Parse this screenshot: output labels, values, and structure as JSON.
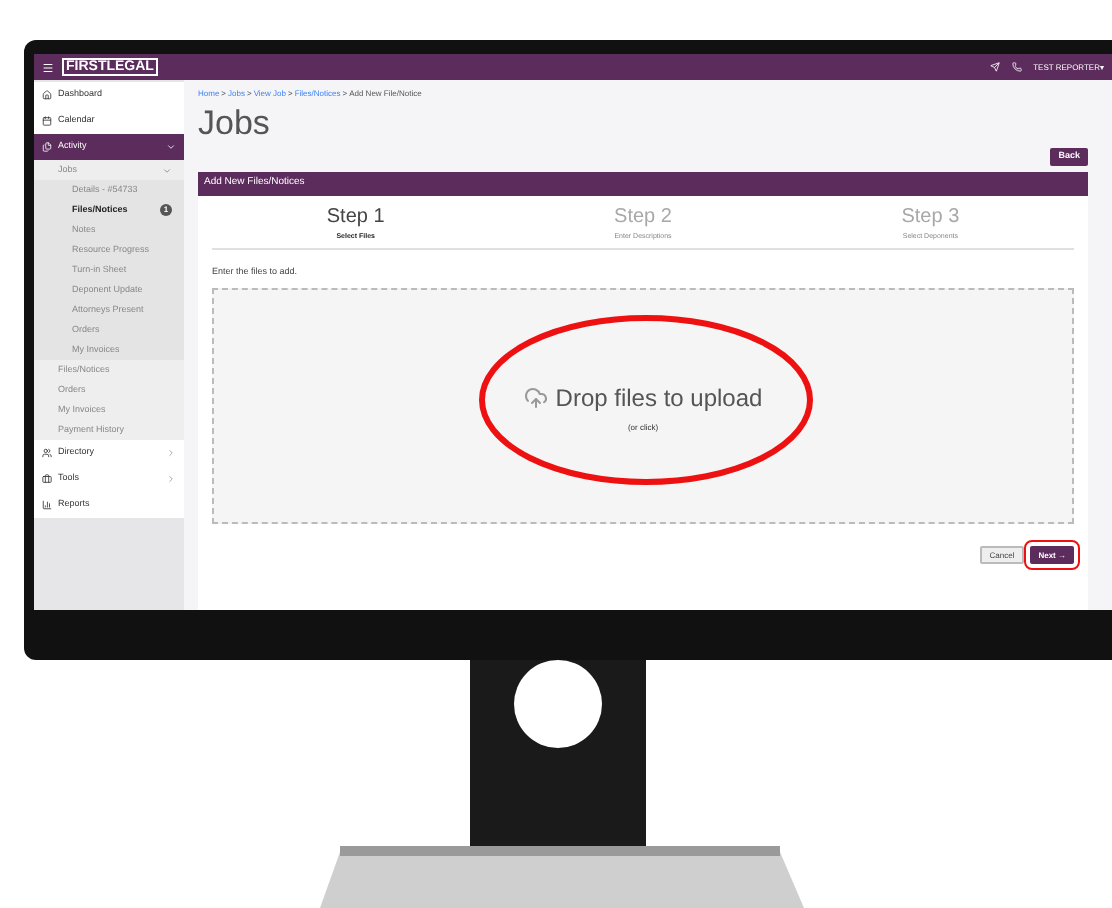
{
  "topbar": {
    "logo": "FIRSTLEGAL",
    "user": "TEST REPORTER▾"
  },
  "sidebar": {
    "items": [
      {
        "label": "Dashboard",
        "selected": false
      },
      {
        "label": "Calendar",
        "selected": false
      },
      {
        "label": "Activity",
        "selected": true,
        "expanded": true,
        "children": [
          {
            "label": "Jobs",
            "selected": false,
            "expanded": true,
            "children": [
              {
                "label": "Details - #54733",
                "selected": false
              },
              {
                "label": "Files/Notices",
                "selected": true,
                "badge": "1"
              },
              {
                "label": "Notes",
                "selected": false
              },
              {
                "label": "Resource Progress",
                "selected": false
              },
              {
                "label": "Turn-in Sheet",
                "selected": false
              },
              {
                "label": "Deponent Update",
                "selected": false
              },
              {
                "label": "Attorneys Present",
                "selected": false
              },
              {
                "label": "Orders",
                "selected": false
              },
              {
                "label": "My Invoices",
                "selected": false
              }
            ]
          },
          {
            "label": "Files/Notices",
            "selected": false
          },
          {
            "label": "Orders",
            "selected": false
          },
          {
            "label": "My Invoices",
            "selected": false
          },
          {
            "label": "Payment History",
            "selected": false
          }
        ]
      },
      {
        "label": "Directory",
        "selected": false,
        "expanded": false
      },
      {
        "label": "Tools",
        "selected": false,
        "expanded": false
      },
      {
        "label": "Reports",
        "selected": false
      }
    ]
  },
  "breadcrumb": {
    "separator": ">",
    "items": [
      "Home",
      "Jobs",
      "View Job",
      "Files/Notices",
      "Add New File/Notice"
    ]
  },
  "page_title": "Jobs",
  "back_button": "Back",
  "panel": {
    "title": "Add New Files/Notices",
    "steps": [
      {
        "title": "Step 1",
        "subtitle": "Select Files",
        "selected": true
      },
      {
        "title": "Step 2",
        "subtitle": "Enter Descriptions",
        "selected": false
      },
      {
        "title": "Step 3",
        "subtitle": "Select Deponents",
        "selected": false
      }
    ],
    "instruction": "Enter the files to add.",
    "dropzone": {
      "text": "Drop files to upload",
      "hint": "(or click)"
    },
    "buttons": [
      {
        "label": "Cancel",
        "kind": "secondary"
      },
      {
        "label": "Next →",
        "kind": "primary"
      }
    ]
  }
}
